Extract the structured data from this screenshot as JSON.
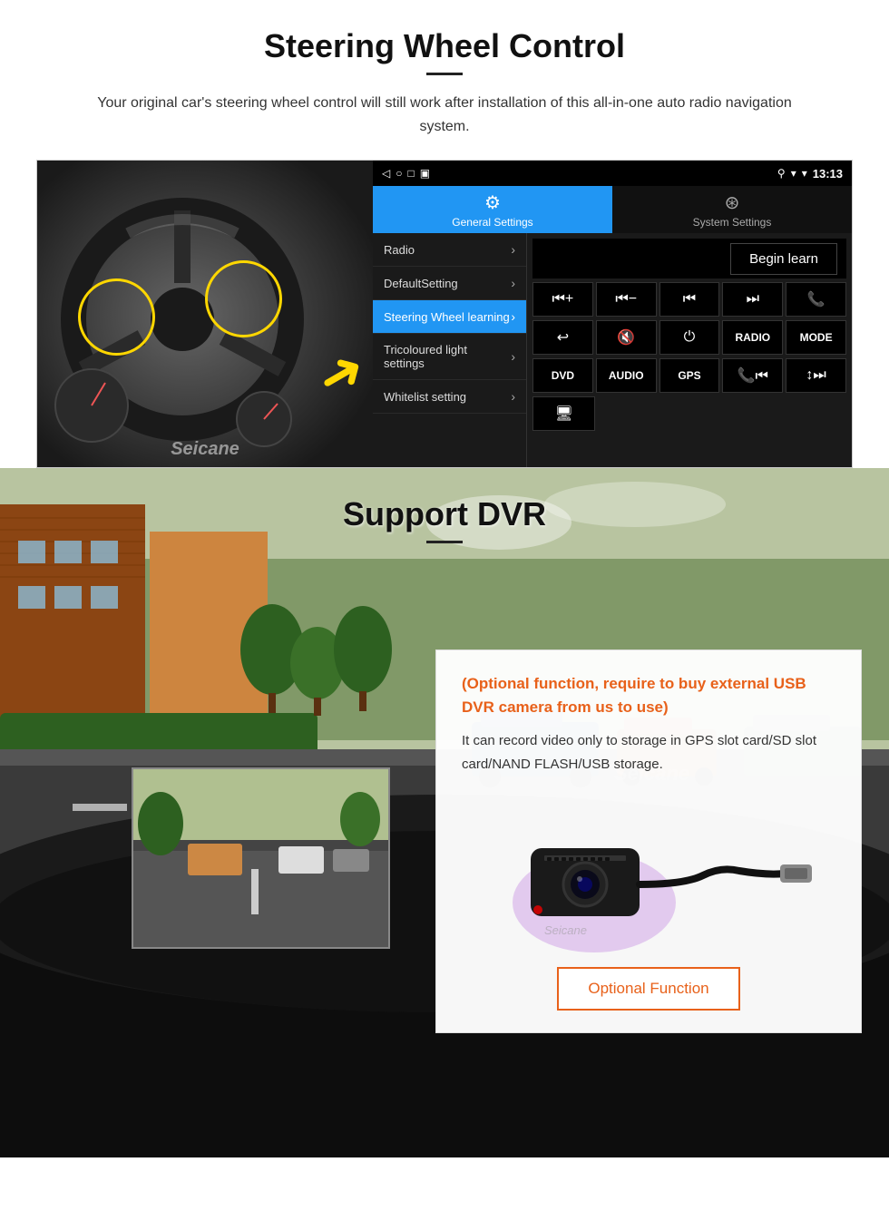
{
  "steering": {
    "title": "Steering Wheel Control",
    "subtitle": "Your original car's steering wheel control will still work after installation of this all-in-one auto radio navigation system.",
    "statusbar": {
      "nav_icons": "◁  ○  □  ▣",
      "signal": "▼",
      "wifi": "▾",
      "time": "13:13"
    },
    "tabs": {
      "general": "General Settings",
      "system": "System Settings"
    },
    "menu": [
      {
        "label": "Radio",
        "active": false
      },
      {
        "label": "DefaultSetting",
        "active": false
      },
      {
        "label": "Steering Wheel learning",
        "active": true
      },
      {
        "label": "Tricoloured light settings",
        "active": false
      },
      {
        "label": "Whitelist setting",
        "active": false
      }
    ],
    "begin_learn": "Begin learn",
    "controls": [
      {
        "label": "⏮+",
        "type": "icon"
      },
      {
        "label": "⏮−",
        "type": "icon"
      },
      {
        "label": "⏮⏮",
        "type": "icon"
      },
      {
        "label": "⏭⏭",
        "type": "icon"
      },
      {
        "label": "📞",
        "type": "icon"
      },
      {
        "label": "↩",
        "type": "icon"
      },
      {
        "label": "🔇",
        "type": "icon"
      },
      {
        "label": "⏻",
        "type": "icon"
      },
      {
        "label": "RADIO",
        "type": "text"
      },
      {
        "label": "MODE",
        "type": "text"
      },
      {
        "label": "DVD",
        "type": "text"
      },
      {
        "label": "AUDIO",
        "type": "text"
      },
      {
        "label": "GPS",
        "type": "text"
      },
      {
        "label": "📞⏮",
        "type": "icon"
      },
      {
        "label": "↕⏭",
        "type": "icon"
      }
    ]
  },
  "dvr": {
    "title": "Support DVR",
    "optional_text": "(Optional function, require to buy external USB DVR camera from us to use)",
    "desc_text": "It can record video only to storage in GPS slot card/SD slot card/NAND FLASH/USB storage.",
    "optional_button": "Optional Function",
    "seicane": "Seicane"
  }
}
